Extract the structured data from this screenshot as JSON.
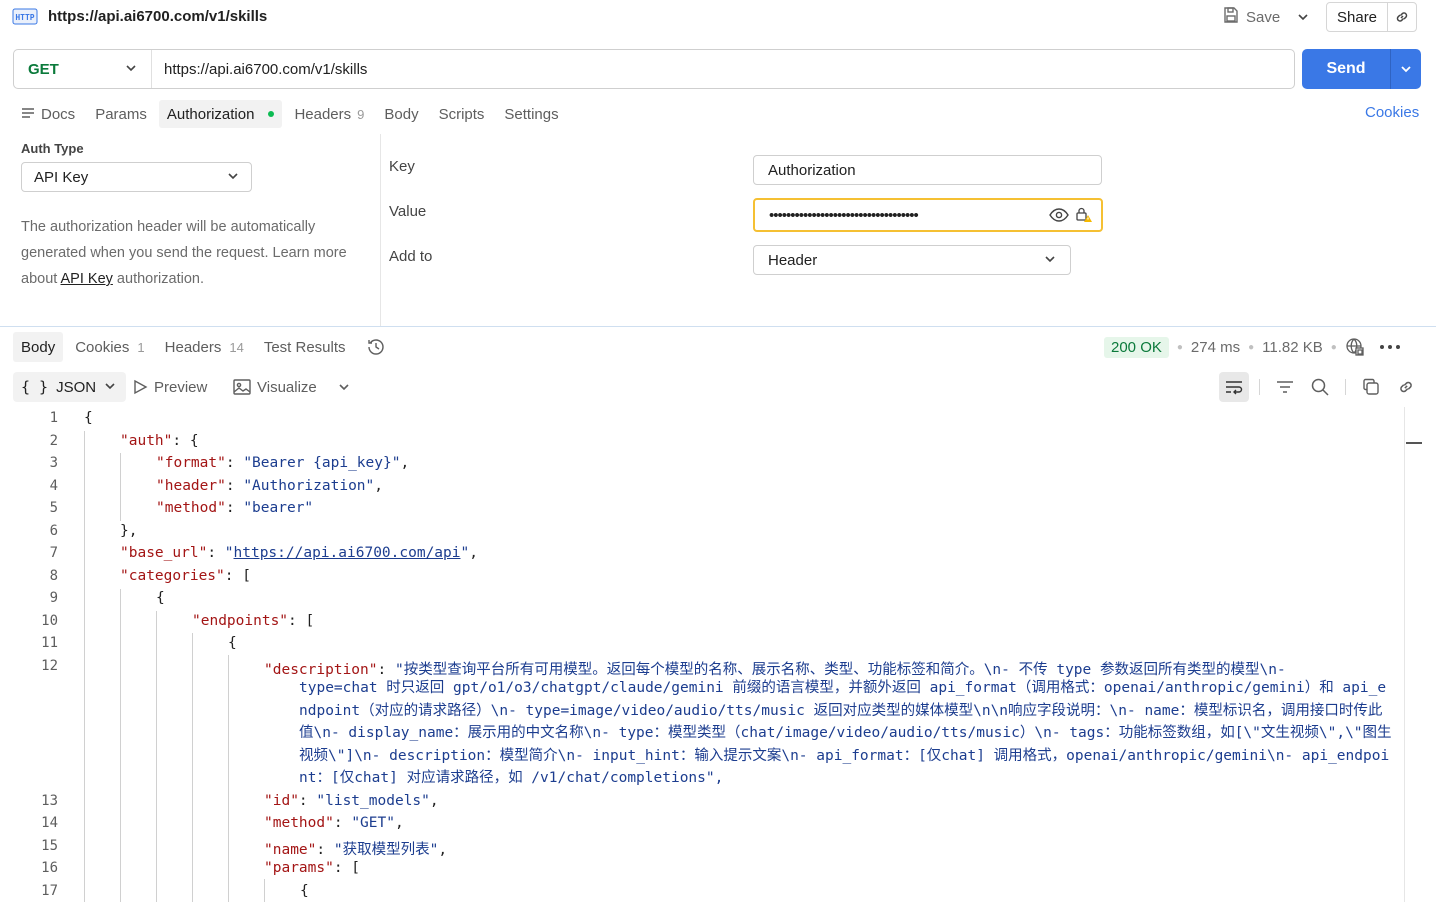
{
  "request": {
    "title": "https://api.ai6700.com/v1/skills",
    "save_label": "Save",
    "share_label": "Share",
    "method": "GET",
    "url": "https://api.ai6700.com/v1/skills",
    "send_label": "Send",
    "cookies_link": "Cookies"
  },
  "req_tabs": [
    {
      "label": "Docs"
    },
    {
      "label": "Params"
    },
    {
      "label": "Authorization"
    },
    {
      "label": "Headers",
      "count": "9"
    },
    {
      "label": "Body"
    },
    {
      "label": "Scripts"
    },
    {
      "label": "Settings"
    }
  ],
  "auth": {
    "type_label": "Auth Type",
    "type_value": "API Key",
    "desc_prefix": "The authorization header will be automatically generated when you send the request. Learn more about ",
    "desc_link": "API Key",
    "desc_suffix": " authorization.",
    "key_label": "Key",
    "key_value": "Authorization",
    "value_label": "Value",
    "value_masked": "•••••••••••••••••••••••••••••••••••",
    "addto_label": "Add to",
    "addto_value": "Header"
  },
  "resp_tabs": [
    {
      "label": "Body"
    },
    {
      "label": "Cookies",
      "count": "1"
    },
    {
      "label": "Headers",
      "count": "14"
    },
    {
      "label": "Test Results"
    }
  ],
  "status": {
    "code": "200 OK",
    "time": "274 ms",
    "size": "11.82 KB"
  },
  "toolbar": {
    "format": "JSON",
    "preview": "Preview",
    "visualize": "Visualize"
  },
  "code": {
    "line_numbers": [
      "1",
      "2",
      "3",
      "4",
      "5",
      "6",
      "7",
      "8",
      "9",
      "10",
      "11",
      "12",
      "13",
      "14",
      "15",
      "16",
      "17"
    ],
    "l1": "{",
    "l2_key": "\"auth\"",
    "l2_rest": ": {",
    "l3_key": "\"format\"",
    "l3_val": "\"Bearer {api_key}\"",
    "l4_key": "\"header\"",
    "l4_val": "\"Authorization\"",
    "l5_key": "\"method\"",
    "l5_val": "\"bearer\"",
    "l6": "},",
    "l7_key": "\"base_url\"",
    "l7_q1": "\"",
    "l7_url": "https://api.ai6700.com/api",
    "l7_q2": "\"",
    "l8_key": "\"categories\"",
    "l8_rest": ": [",
    "l9": "{",
    "l10_key": "\"endpoints\"",
    "l10_rest": ": [",
    "l11": "{",
    "l12_key": "\"description\"",
    "l12_first": "\"按类型查询平台所有可用模型。返回每个模型的名称、展示名称、类型、功能标签和简介。\\n- 不传 type 参数返回所有类型的模型\\n-",
    "l12_wrap": "type=chat 时只返回 gpt/o1/o3/chatgpt/claude/gemini 前缀的语言模型，并额外返回 api_format（调用格式：openai/anthropic/gemini）和 api_endpoint（对应的请求路径）\\n- type=image/video/audio/tts/music 返回对应类型的媒体模型\\n\\n响应字段说明：\\n- name：模型标识名，调用接口时传此值\\n- display_name：展示用的中文名称\\n- type：模型类型（chat/image/video/audio/tts/music）\\n- tags：功能标签数组，如[\\\"文生视频\\\",\\\"图生视频\\\"]\\n- description：模型简介\\n- input_hint：输入提示文案\\n- api_format：[仅chat] 调用格式，openai/anthropic/gemini\\n- api_endpoint：[仅chat] 对应请求路径，如 /v1/chat/completions\",",
    "l13_key": "\"id\"",
    "l13_val": "\"list_models\"",
    "l14_key": "\"method\"",
    "l14_val": "\"GET\"",
    "l15_key": "\"name\"",
    "l15_val": "\"获取模型列表\"",
    "l16_key": "\"params\"",
    "l16_rest": ": [",
    "l17": "{"
  },
  "colors": {
    "accent": "#3a78e6",
    "status_ok": "#0b7a3b",
    "warn_border": "#f5c033",
    "json_key": "#a31515",
    "json_string": "#1c3d8f"
  }
}
